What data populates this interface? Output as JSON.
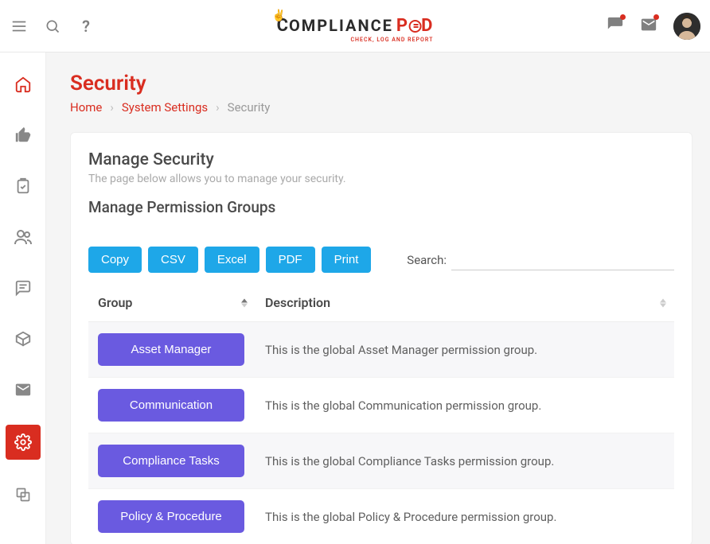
{
  "brand": {
    "name_main": "OMPLIANCE",
    "name_accent1": "P",
    "name_accent2": "D",
    "tagline": "CHECK, LOG AND REPORT"
  },
  "page": {
    "title": "Security"
  },
  "breadcrumb": {
    "home": "Home",
    "settings": "System Settings",
    "current": "Security"
  },
  "card": {
    "title": "Manage Security",
    "subtitle": "The page below allows you to manage your security.",
    "section": "Manage Permission Groups"
  },
  "export_buttons": {
    "copy": "Copy",
    "csv": "CSV",
    "excel": "Excel",
    "pdf": "PDF",
    "print": "Print"
  },
  "search": {
    "label": "Search:",
    "value": ""
  },
  "table": {
    "col_group": "Group",
    "col_desc": "Description",
    "rows": [
      {
        "group": "Asset Manager",
        "desc": "This is the global Asset Manager permission group."
      },
      {
        "group": "Communication",
        "desc": "This is the global Communication permission group."
      },
      {
        "group": "Compliance Tasks",
        "desc": "This is the global Compliance Tasks permission group."
      },
      {
        "group": "Policy & Procedure",
        "desc": "This is the global Policy & Procedure permission group."
      }
    ]
  }
}
